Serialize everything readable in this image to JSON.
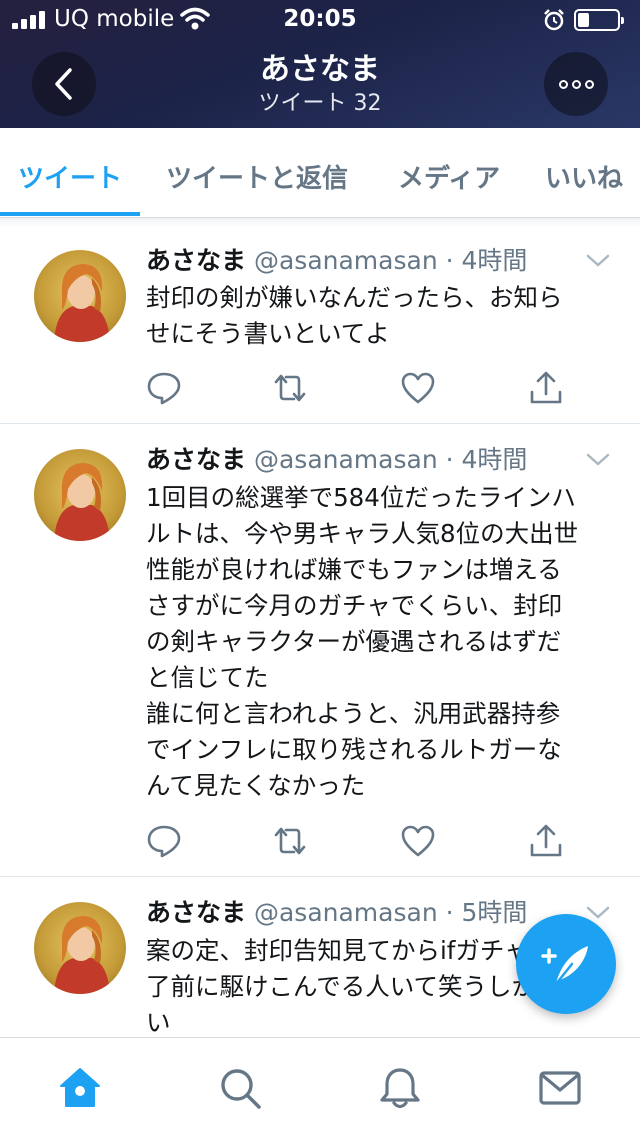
{
  "status_bar": {
    "carrier": "UQ mobile",
    "time": "20:05",
    "battery_level": 0.3
  },
  "header": {
    "title": "あさなま",
    "subtitle": "ツイート 32",
    "back_icon": "chevron-left-icon",
    "more_icon": "more-horizontal-icon"
  },
  "tabs": [
    {
      "label": "ツイート",
      "active": true
    },
    {
      "label": "ツイートと返信",
      "active": false
    },
    {
      "label": "メディア",
      "active": false
    },
    {
      "label": "いいね",
      "active": false
    }
  ],
  "tweets": [
    {
      "name": "あさなま",
      "handle": "@asanamasan",
      "time": "· 4時間",
      "text": "封印の剣が嫌いなんだったら、お知ら\nせにそう書いといてよ"
    },
    {
      "name": "あさなま",
      "handle": "@asanamasan",
      "time": "· 4時間",
      "text": "1回目の総選挙で584位だったラインハ\nルトは、今や男キャラ人気8位の大出世\n性能が良ければ嫌でもファンは増える\nさすがに今月のガチャでくらい、封印\nの剣キャラクターが優遇されるはずだ\nと信じてた\n誰に何と言われようと、汎用武器持参\nでインフレに取り残されるルトガーな\nんて見たくなかった"
    },
    {
      "name": "あさなま",
      "handle": "@asanamasan",
      "time": "· 5時間",
      "text": "案の定、封印告知見てからifガチャ終\n了前に駆けこんでる人いて笑うしかな\nい"
    }
  ],
  "actions": [
    "reply-icon",
    "retweet-icon",
    "like-icon",
    "share-icon"
  ],
  "bottom_nav": [
    "home-icon",
    "search-icon",
    "notifications-icon",
    "messages-icon"
  ],
  "colors": {
    "accent": "#1da1f2",
    "secondary_text": "#657786",
    "icon": "#657786"
  }
}
